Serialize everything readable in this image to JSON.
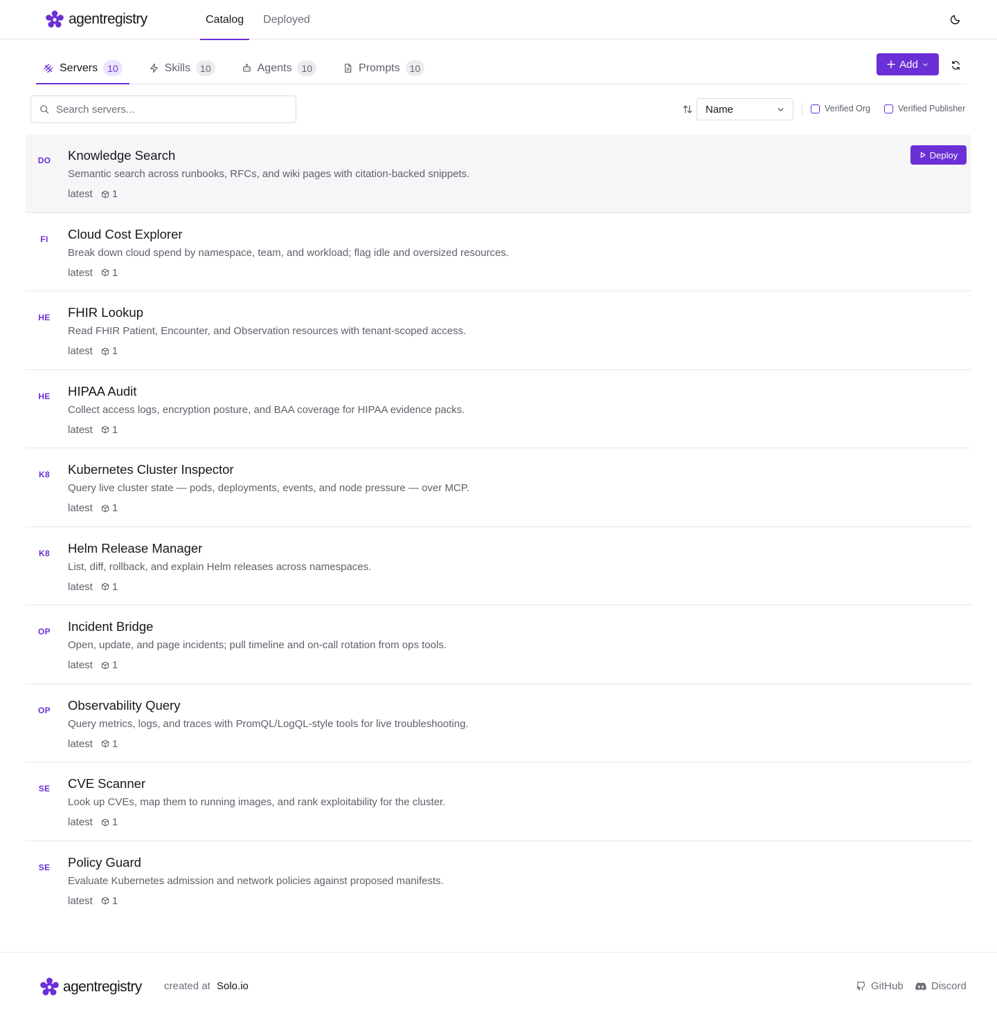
{
  "brand": {
    "name_light": "agent",
    "name_bold": "registry",
    "color": "#6b2fd6"
  },
  "nav": {
    "items": [
      {
        "label": "Catalog",
        "active": true
      },
      {
        "label": "Deployed",
        "active": false
      }
    ]
  },
  "header": {
    "theme_icon": "moon-icon"
  },
  "tabs": [
    {
      "label": "Servers",
      "count": "10",
      "icon": "server-icon",
      "active": true
    },
    {
      "label": "Skills",
      "count": "10",
      "icon": "lightning-icon",
      "active": false
    },
    {
      "label": "Agents",
      "count": "10",
      "icon": "bot-icon",
      "active": false
    },
    {
      "label": "Prompts",
      "count": "10",
      "icon": "document-icon",
      "active": false
    }
  ],
  "actions": {
    "add_label": "Add",
    "refresh_icon": "refresh-icon"
  },
  "search": {
    "placeholder": "Search servers...",
    "value": ""
  },
  "filters": {
    "sort_value": "Name",
    "verified_org": {
      "label": "Verified Org",
      "checked": false
    },
    "verified_publisher": {
      "label": "Verified Publisher",
      "checked": false
    }
  },
  "deploy_label": "Deploy",
  "servers": [
    {
      "abbr": "DO",
      "name": "Knowledge Search",
      "description": "Semantic search across runbooks, RFCs, and wiki pages with citation-backed snippets.",
      "version": "latest",
      "count": "1",
      "hovered": true
    },
    {
      "abbr": "FI",
      "name": "Cloud Cost Explorer",
      "description": "Break down cloud spend by namespace, team, and workload; flag idle and oversized resources.",
      "version": "latest",
      "count": "1"
    },
    {
      "abbr": "HE",
      "name": "FHIR Lookup",
      "description": "Read FHIR Patient, Encounter, and Observation resources with tenant-scoped access.",
      "version": "latest",
      "count": "1"
    },
    {
      "abbr": "HE",
      "name": "HIPAA Audit",
      "description": "Collect access logs, encryption posture, and BAA coverage for HIPAA evidence packs.",
      "version": "latest",
      "count": "1"
    },
    {
      "abbr": "K8",
      "name": "Kubernetes Cluster Inspector",
      "description": "Query live cluster state — pods, deployments, events, and node pressure — over MCP.",
      "version": "latest",
      "count": "1"
    },
    {
      "abbr": "K8",
      "name": "Helm Release Manager",
      "description": "List, diff, rollback, and explain Helm releases across namespaces.",
      "version": "latest",
      "count": "1"
    },
    {
      "abbr": "OP",
      "name": "Incident Bridge",
      "description": "Open, update, and page incidents; pull timeline and on-call rotation from ops tools.",
      "version": "latest",
      "count": "1"
    },
    {
      "abbr": "OP",
      "name": "Observability Query",
      "description": "Query metrics, logs, and traces with PromQL/LogQL-style tools for live troubleshooting.",
      "version": "latest",
      "count": "1"
    },
    {
      "abbr": "SE",
      "name": "CVE Scanner",
      "description": "Look up CVEs, map them to running images, and rank exploitability for the cluster.",
      "version": "latest",
      "count": "1"
    },
    {
      "abbr": "SE",
      "name": "Policy Guard",
      "description": "Evaluate Kubernetes admission and network policies against proposed manifests.",
      "version": "latest",
      "count": "1"
    }
  ],
  "footer": {
    "created_at": "created at",
    "company": "Solo.io",
    "github": "GitHub",
    "discord": "Discord"
  }
}
